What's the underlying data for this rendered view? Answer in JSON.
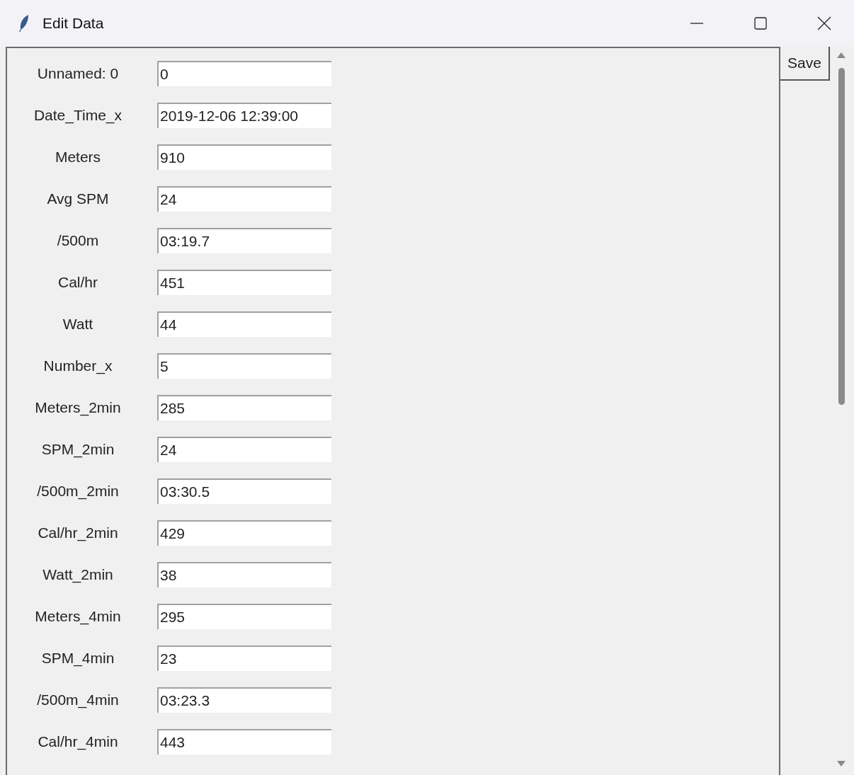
{
  "window": {
    "title": "Edit Data"
  },
  "fields": [
    {
      "label": "Unnamed: 0",
      "value": "0"
    },
    {
      "label": "Date_Time_x",
      "value": "2019-12-06 12:39:00"
    },
    {
      "label": "Meters",
      "value": "910"
    },
    {
      "label": "Avg SPM",
      "value": "24"
    },
    {
      "label": "/500m",
      "value": "03:19.7"
    },
    {
      "label": "Cal/hr",
      "value": "451"
    },
    {
      "label": "Watt",
      "value": "44"
    },
    {
      "label": "Number_x",
      "value": "5"
    },
    {
      "label": "Meters_2min",
      "value": "285"
    },
    {
      "label": "SPM_2min",
      "value": "24"
    },
    {
      "label": "/500m_2min",
      "value": "03:30.5"
    },
    {
      "label": "Cal/hr_2min",
      "value": "429"
    },
    {
      "label": "Watt_2min",
      "value": "38"
    },
    {
      "label": "Meters_4min",
      "value": "295"
    },
    {
      "label": "SPM_4min",
      "value": "23"
    },
    {
      "label": "/500m_4min",
      "value": "03:23.3"
    },
    {
      "label": "Cal/hr_4min",
      "value": "443"
    }
  ],
  "save_button": "Save"
}
